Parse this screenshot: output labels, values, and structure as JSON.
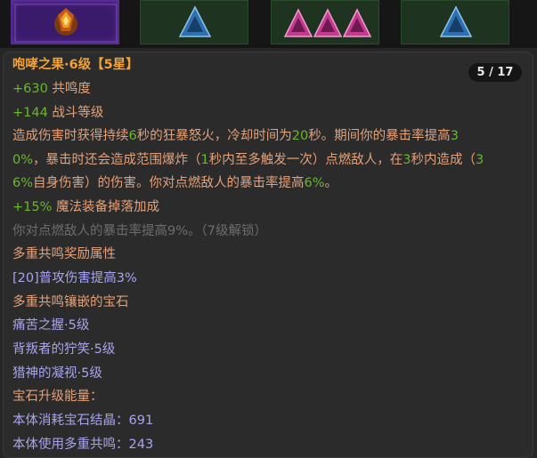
{
  "gem_slots": [
    {
      "icon": "legendary-gem-icon",
      "kind": "legendary"
    },
    {
      "icon": "blue-triangle-icon",
      "count": 1,
      "color": "#2e6fb0"
    },
    {
      "icon": "pink-triangle-icon",
      "count": 3,
      "color": "#c23b8e"
    },
    {
      "icon": "blue-triangle-icon",
      "count": 1,
      "color": "#2e6fb0"
    }
  ],
  "tooltip": {
    "page": "5 / 17",
    "title": "咆哮之果·6级【5星】",
    "stats": [
      {
        "value": "+630",
        "label": " 共鸣度"
      },
      {
        "value": "+144",
        "label": " 战斗等级"
      }
    ],
    "desc1": {
      "a": "造成伤害时获得持续",
      "b": "6",
      "c": "秒的狂暴怒火，冷却时间为",
      "d": "20",
      "e": "秒。期间你的暴击率提高",
      "f": "3"
    },
    "desc2": {
      "a": "0%",
      "b": "，暴击时还会造成范围爆炸（",
      "c": "1",
      "d": "秒内至多触发一次）点燃敌人，在",
      "e": "3",
      "f": "秒内造成（",
      "g": "3"
    },
    "desc3": {
      "a": "6%",
      "b": "自身伤害）的伤害。你对点燃敌人的暴击率提高",
      "c": "6%",
      "d": "。"
    },
    "bonus": {
      "value": "+15%",
      "label": " 魔法装备掉落加成"
    },
    "locked": "你对点燃敌人的暴击率提高9%。（7级解锁）",
    "multi_header": "多重共鸣奖励属性",
    "multi_bonus": "[20]普攻伤害提高3%",
    "socketed_header": "多重共鸣镶嵌的宝石",
    "socketed_gems": [
      "痛苦之握·5级",
      "背叛者的狞笑·5级",
      "猎神的凝视·5级"
    ],
    "upgrade_header": "宝石升级能量：",
    "consumed_label": "本体消耗宝石结晶：",
    "consumed_value": "691",
    "resonance_label": "本体使用多重共鸣：",
    "resonance_value": "243"
  },
  "colors": {
    "title": "#f0a13a",
    "green": "#6ab82a",
    "orange": "#e4a17a",
    "purple": "#a7a4ee",
    "dim": "#6d6d6d"
  }
}
